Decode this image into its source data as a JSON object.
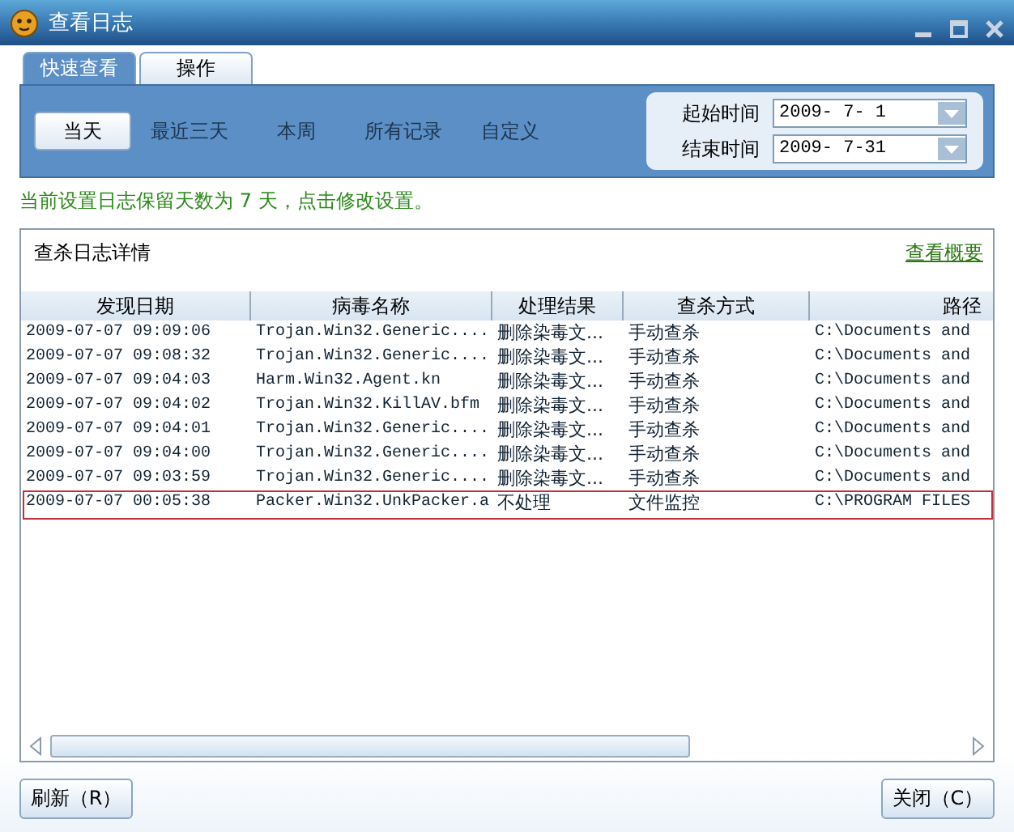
{
  "window": {
    "title": "查看日志"
  },
  "tabs": [
    {
      "label": "快速查看",
      "selected": true
    },
    {
      "label": "操作",
      "selected": false
    }
  ],
  "filters": [
    {
      "label": "当天",
      "selected": true
    },
    {
      "label": "最近三天",
      "selected": false
    },
    {
      "label": "本周",
      "selected": false
    },
    {
      "label": "所有记录",
      "selected": false
    },
    {
      "label": "自定义",
      "selected": false
    }
  ],
  "date_range": [
    {
      "label": "起始时间",
      "value": "2009- 7- 1"
    },
    {
      "label": "结束时间",
      "value": "2009- 7-31"
    }
  ],
  "notice": "当前设置日志保留天数为 7 天，点击修改设置。",
  "log_panel": {
    "title": "查杀日志详情",
    "summary_link": "查看概要",
    "columns": [
      "发现日期",
      "病毒名称",
      "处理结果",
      "查杀方式",
      "路径"
    ],
    "rows": [
      {
        "cells": [
          "2009-07-07 09:09:06",
          "Trojan.Win32.Generic....",
          "删除染毒文...",
          "手动查杀",
          "C:\\Documents and"
        ],
        "selected": false
      },
      {
        "cells": [
          "2009-07-07 09:08:32",
          "Trojan.Win32.Generic....",
          "删除染毒文...",
          "手动查杀",
          "C:\\Documents and"
        ],
        "selected": false
      },
      {
        "cells": [
          "2009-07-07 09:04:03",
          "Harm.Win32.Agent.kn",
          "删除染毒文...",
          "手动查杀",
          "C:\\Documents and"
        ],
        "selected": false
      },
      {
        "cells": [
          "2009-07-07 09:04:02",
          "Trojan.Win32.KillAV.bfm",
          "删除染毒文...",
          "手动查杀",
          "C:\\Documents and"
        ],
        "selected": false
      },
      {
        "cells": [
          "2009-07-07 09:04:01",
          "Trojan.Win32.Generic....",
          "删除染毒文...",
          "手动查杀",
          "C:\\Documents and"
        ],
        "selected": false
      },
      {
        "cells": [
          "2009-07-07 09:04:00",
          "Trojan.Win32.Generic....",
          "删除染毒文...",
          "手动查杀",
          "C:\\Documents and"
        ],
        "selected": false
      },
      {
        "cells": [
          "2009-07-07 09:03:59",
          "Trojan.Win32.Generic....",
          "删除染毒文...",
          "手动查杀",
          "C:\\Documents and"
        ],
        "selected": false
      },
      {
        "cells": [
          "2009-07-07 00:05:38",
          "Packer.Win32.UnkPacker.a",
          "不处理",
          "文件监控",
          "C:\\PROGRAM FILES"
        ],
        "selected": true
      }
    ]
  },
  "buttons": [
    "刷新（R）",
    "关闭（C）"
  ]
}
